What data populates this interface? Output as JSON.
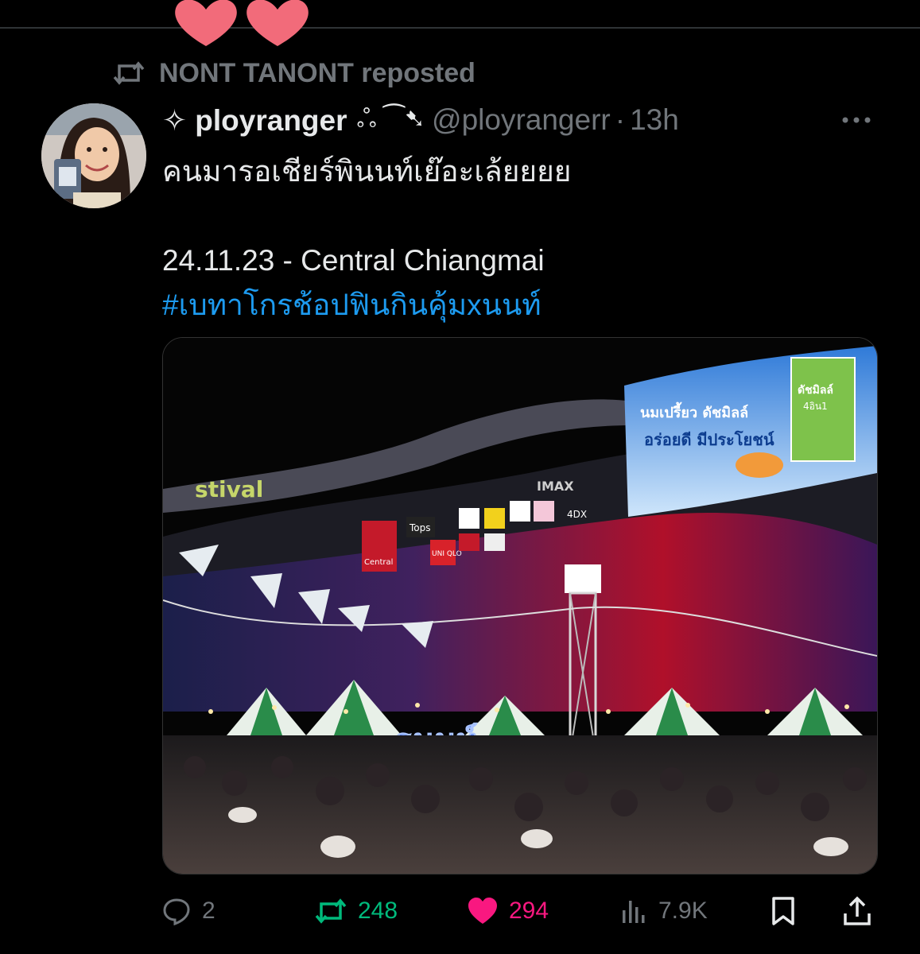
{
  "repost_banner": {
    "text": "NONT TANONT reposted",
    "icon": "repost-icon"
  },
  "tweet": {
    "author": {
      "display_name": "✧ ployranger",
      "name_decoration": "ஃ ⁀➷",
      "handle": "@ployrangerr",
      "separator": "·",
      "time": "13h"
    },
    "text_lines": [
      "คนมารอเชียร์พินนท์เย๊อะเล้ยยยย",
      "24.11.23 - Central Chiangmai"
    ],
    "hashtag": "#เบทาโกรช้อปฟินกินคุ้มxนนท์",
    "image": {
      "billboard_line1": "นมเปรี้ยว ดัชมิลล์",
      "billboard_line2": "อร่อยดี มีประโยชน์",
      "product_label": "ดัชมิลล์",
      "product_sub": "4อิน1",
      "mall_sign": "stival",
      "central_logo_text": "Central",
      "store_tops": "Tops",
      "store_uniqlo": "UNI QLO",
      "store_imax": "IMAX",
      "store_4dx": "4DX",
      "neon_sign": "ธนนท์"
    },
    "stats": {
      "replies": "2",
      "reposts": "248",
      "likes": "294",
      "views": "7.9K"
    }
  },
  "colors": {
    "background": "#000000",
    "text_primary": "#e7e9ea",
    "text_secondary": "#71767b",
    "link_blue": "#1d9bf0",
    "repost_green": "#00ba7c",
    "like_pink": "#f91880"
  }
}
